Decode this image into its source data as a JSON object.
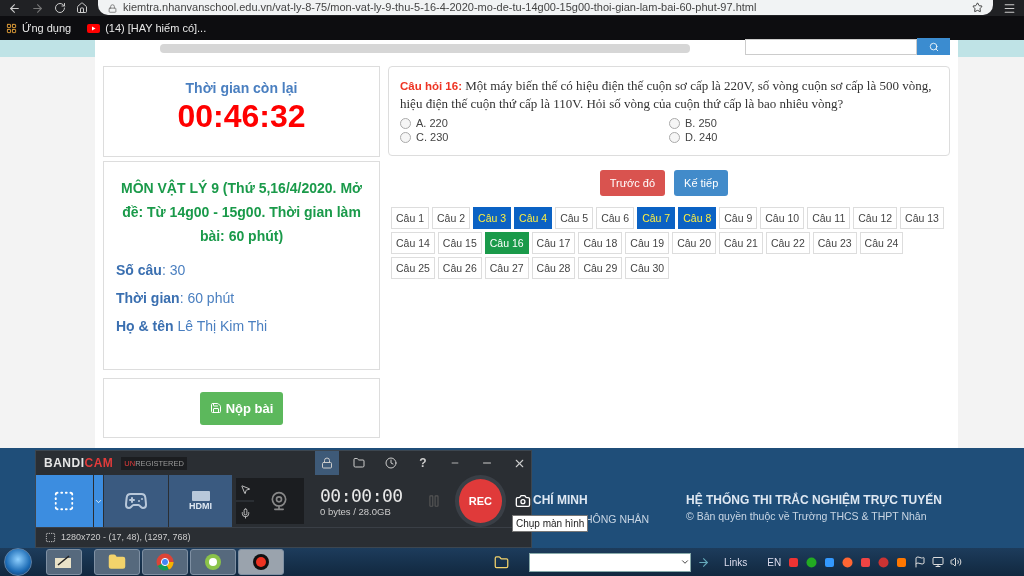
{
  "browser": {
    "url": "kiemtra.nhanvanschool.edu.vn/vat-ly-8-75/mon-vat-ly-9-thu-5-16-4-2020-mo-de-tu-14g00-15g00-thoi-gian-lam-bai-60-phut-97.html",
    "bookmarks": [
      {
        "kind": "apps",
        "label": "Ứng dụng"
      },
      {
        "kind": "video",
        "label": "(14) [HAY hiếm có]..."
      }
    ]
  },
  "timer": {
    "title": "Thời gian còn lại",
    "value": "00:46:32"
  },
  "exam": {
    "title": "MÔN VẬT LÝ 9 (Thứ 5,16/4/2020. Mở đề: Từ 14g00 - 15g00. Thời gian làm bài: 60 phút)",
    "fields": [
      "**Số câu**: 30",
      "**Thời gian**: 60 phút",
      "**Họ & tên** Lê Thị Kim Thi"
    ]
  },
  "submit": {
    "label": "Nộp bài"
  },
  "question": {
    "text": "**Câu hỏi 16:** Một máy biến thế có hiệu điện thế cuộn sơ cấp là 220V, số vòng cuộn sơ cấp là 500 vòng, hiệu điện thế cuộn thứ cấp là 110V. Hỏi số vòng của cuộn thứ cấp là bao nhiêu vòng?",
    "options": [
      {
        "label": "A. 220",
        "selected": false
      },
      {
        "label": "B. 250",
        "selected": false
      },
      {
        "label": "C. 230",
        "selected": false
      },
      {
        "label": "D. 240",
        "selected": false
      }
    ]
  },
  "nav": [
    {
      "kind": "prev",
      "label": "Trước đó"
    },
    {
      "kind": "next",
      "label": "Kế tiếp"
    }
  ],
  "questions": [
    {
      "label": "Câu 1",
      "answered": false,
      "selected": false
    },
    {
      "label": "Câu 2",
      "answered": false,
      "selected": false
    },
    {
      "label": "Câu 3",
      "answered": true,
      "selected": false
    },
    {
      "label": "Câu 4",
      "answered": true,
      "selected": false
    },
    {
      "label": "Câu 5",
      "answered": false,
      "selected": false
    },
    {
      "label": "Câu 6",
      "answered": false,
      "selected": false
    },
    {
      "label": "Câu 7",
      "answered": true,
      "selected": false
    },
    {
      "label": "Câu 8",
      "answered": true,
      "selected": false
    },
    {
      "label": "Câu 9",
      "answered": false,
      "selected": false
    },
    {
      "label": "Câu 10",
      "answered": false,
      "selected": false
    },
    {
      "label": "Câu 11",
      "answered": false,
      "selected": false
    },
    {
      "label": "Câu 12",
      "answered": false,
      "selected": false
    },
    {
      "label": "Câu 13",
      "answered": false,
      "selected": false
    },
    {
      "label": "Câu 14",
      "answered": false,
      "selected": false
    },
    {
      "label": "Câu 15",
      "answered": false,
      "selected": false
    },
    {
      "label": "Câu 16",
      "answered": false,
      "selected": true
    },
    {
      "label": "Câu 17",
      "answered": false,
      "selected": false
    },
    {
      "label": "Câu 18",
      "answered": false,
      "selected": false
    },
    {
      "label": "Câu 19",
      "answered": false,
      "selected": false
    },
    {
      "label": "Câu 20",
      "answered": false,
      "selected": false
    },
    {
      "label": "Câu 21",
      "answered": false,
      "selected": false
    },
    {
      "label": "Câu 22",
      "answered": false,
      "selected": false
    },
    {
      "label": "Câu 23",
      "answered": false,
      "selected": false
    },
    {
      "label": "Câu 24",
      "answered": false,
      "selected": false
    },
    {
      "label": "Câu 25",
      "answered": false,
      "selected": false
    },
    {
      "label": "Câu 26",
      "answered": false,
      "selected": false
    },
    {
      "label": "Câu 27",
      "answered": false,
      "selected": false
    },
    {
      "label": "Câu 28",
      "answered": false,
      "selected": false
    },
    {
      "label": "Câu 29",
      "answered": false,
      "selected": false
    },
    {
      "label": "Câu 30",
      "answered": false,
      "selected": false
    }
  ],
  "footer": {
    "col_1": {
      "heading": "CHÍ MINH",
      "text": "HÔNG NHÂN"
    },
    "col_2": {
      "heading": "HỆ THỐNG THI TRẮC NGHIỆM TRỰC TUYẾN",
      "text": "© Bản quyền thuộc về Trường THCS & THPT Nhân"
    }
  },
  "recorder": {
    "logo": [
      "BANDI",
      "CAM"
    ],
    "badge": [
      "UN",
      "REGISTERED"
    ],
    "help": "?",
    "modes": [
      {
        "kind": "screen",
        "selected": true
      },
      {
        "kind": "game",
        "selected": false
      },
      {
        "kind": "device",
        "label": "HDMI",
        "selected": false
      }
    ],
    "time": "00:00:00",
    "size": "0 bytes / 28.0GB",
    "rec": "REC",
    "region": "1280x720 - (17, 48), (1297, 768)",
    "tooltip": "Chụp màn hình"
  },
  "taskbar": {
    "links": "Links",
    "language": "EN"
  }
}
